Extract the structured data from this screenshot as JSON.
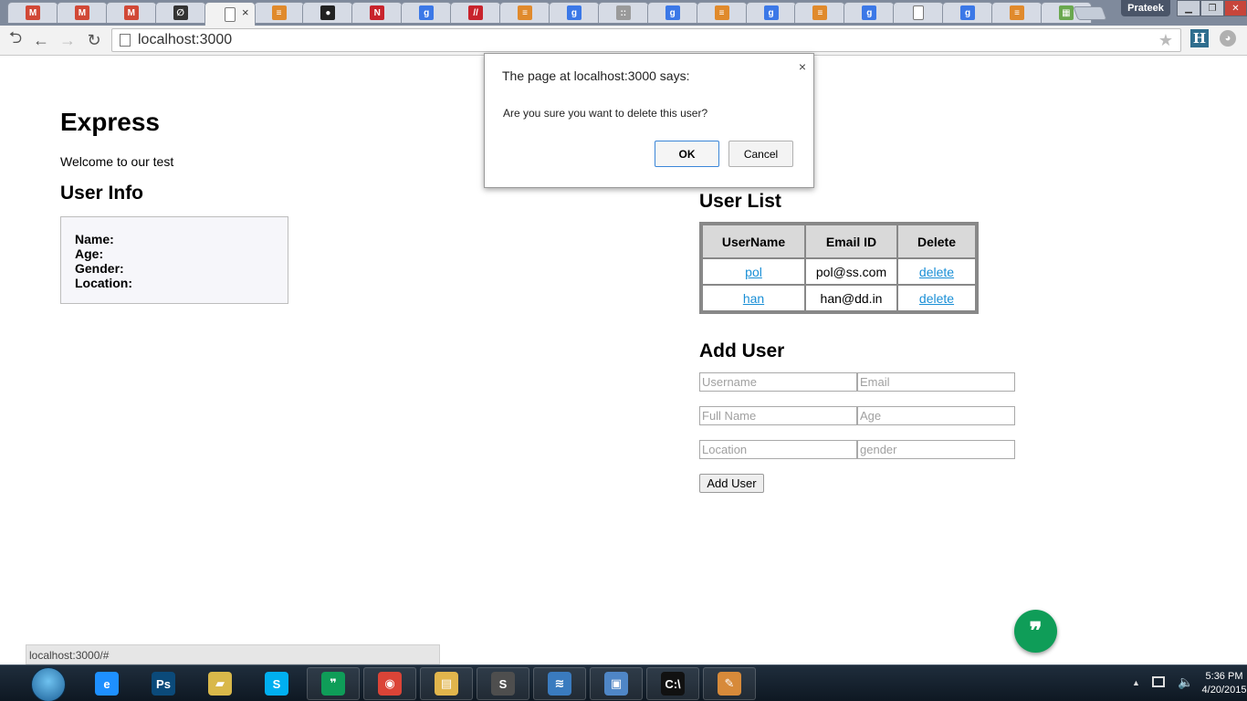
{
  "browser": {
    "tabs": [
      {
        "icon": "gmail-icon",
        "letter": "M",
        "color": "#d14836"
      },
      {
        "icon": "gmail-icon",
        "letter": "M",
        "color": "#d14836"
      },
      {
        "icon": "gmail-icon",
        "letter": "M",
        "color": "#d14836"
      },
      {
        "icon": "script-icon",
        "letter": "∅",
        "color": "#333333"
      },
      {
        "icon": "page-icon",
        "letter": "",
        "color": "#ffffff",
        "active": true
      },
      {
        "icon": "stackoverflow-icon",
        "letter": "≡",
        "color": "#e08a2c"
      },
      {
        "icon": "github-icon",
        "letter": "●",
        "color": "#222222"
      },
      {
        "icon": "n-icon",
        "letter": "N",
        "color": "#c8232c"
      },
      {
        "icon": "google-icon",
        "letter": "g",
        "color": "#3b78e7"
      },
      {
        "icon": "slash-icon",
        "letter": "//",
        "color": "#c8232c"
      },
      {
        "icon": "stackoverflow-icon",
        "letter": "≡",
        "color": "#e08a2c"
      },
      {
        "icon": "google-icon",
        "letter": "g",
        "color": "#3b78e7"
      },
      {
        "icon": "grid-icon",
        "letter": "::",
        "color": "#9a9a9a"
      },
      {
        "icon": "google-icon",
        "letter": "g",
        "color": "#3b78e7"
      },
      {
        "icon": "stackoverflow-icon",
        "letter": "≡",
        "color": "#e08a2c"
      },
      {
        "icon": "google-icon",
        "letter": "g",
        "color": "#3b78e7"
      },
      {
        "icon": "stackoverflow-icon",
        "letter": "≡",
        "color": "#e08a2c"
      },
      {
        "icon": "google-icon",
        "letter": "g",
        "color": "#3b78e7"
      },
      {
        "icon": "page-icon",
        "letter": "",
        "color": "#ffffff"
      },
      {
        "icon": "google-icon",
        "letter": "g",
        "color": "#3b78e7"
      },
      {
        "icon": "stackoverflow-icon",
        "letter": "≡",
        "color": "#e08a2c"
      },
      {
        "icon": "apps-grid-icon",
        "letter": "▦",
        "color": "#6aa84f"
      }
    ],
    "profile_name": "Prateek",
    "url": "localhost:3000"
  },
  "page": {
    "title": "Express",
    "welcome": "Welcome to our test",
    "user_info": {
      "heading": "User Info",
      "fields": [
        "Name:",
        "Age:",
        "Gender:",
        "Location:"
      ]
    },
    "user_list": {
      "heading": "User List",
      "columns": [
        "UserName",
        "Email ID",
        "Delete"
      ],
      "rows": [
        {
          "username": "pol",
          "email": "pol@ss.com",
          "action": "delete"
        },
        {
          "username": "han",
          "email": "han@dd.in",
          "action": "delete"
        }
      ]
    },
    "add_user": {
      "heading": "Add User",
      "placeholders": {
        "username": "Username",
        "email": "Email",
        "fullname": "Full Name",
        "age": "Age",
        "location": "Location",
        "gender": "gender"
      },
      "button_label": "Add User"
    }
  },
  "dialog": {
    "title": "The page at localhost:3000 says:",
    "close": "×",
    "message": "Are you sure you want to delete this user?",
    "ok_label": "OK",
    "cancel_label": "Cancel"
  },
  "status_bar": {
    "url": "localhost:3000/#"
  },
  "taskbar": {
    "apps": [
      {
        "name": "internet-explorer-icon",
        "glyph": "e",
        "color": "#1e90ff"
      },
      {
        "name": "photoshop-icon",
        "glyph": "Ps",
        "color": "#0b4a7a"
      },
      {
        "name": "folder-icon",
        "glyph": "▰",
        "color": "#d9b84a"
      },
      {
        "name": "skype-icon",
        "glyph": "S",
        "color": "#00aff0"
      },
      {
        "name": "hangouts-icon",
        "glyph": "❞",
        "color": "#0f9d58"
      },
      {
        "name": "chrome-icon",
        "glyph": "◉",
        "color": "#db4437"
      },
      {
        "name": "explorer-icon",
        "glyph": "▤",
        "color": "#e1b54c"
      },
      {
        "name": "sublime-icon",
        "glyph": "S",
        "color": "#4e4e4e"
      },
      {
        "name": "network-icon",
        "glyph": "≋",
        "color": "#3a7bbf"
      },
      {
        "name": "control-panel-icon",
        "glyph": "▣",
        "color": "#4f86c6"
      },
      {
        "name": "cmd-icon",
        "glyph": "C:\\",
        "color": "#111111"
      },
      {
        "name": "paint-icon",
        "glyph": "✎",
        "color": "#d78a3a"
      }
    ],
    "time": "5:36 PM",
    "date": "4/20/2015"
  }
}
